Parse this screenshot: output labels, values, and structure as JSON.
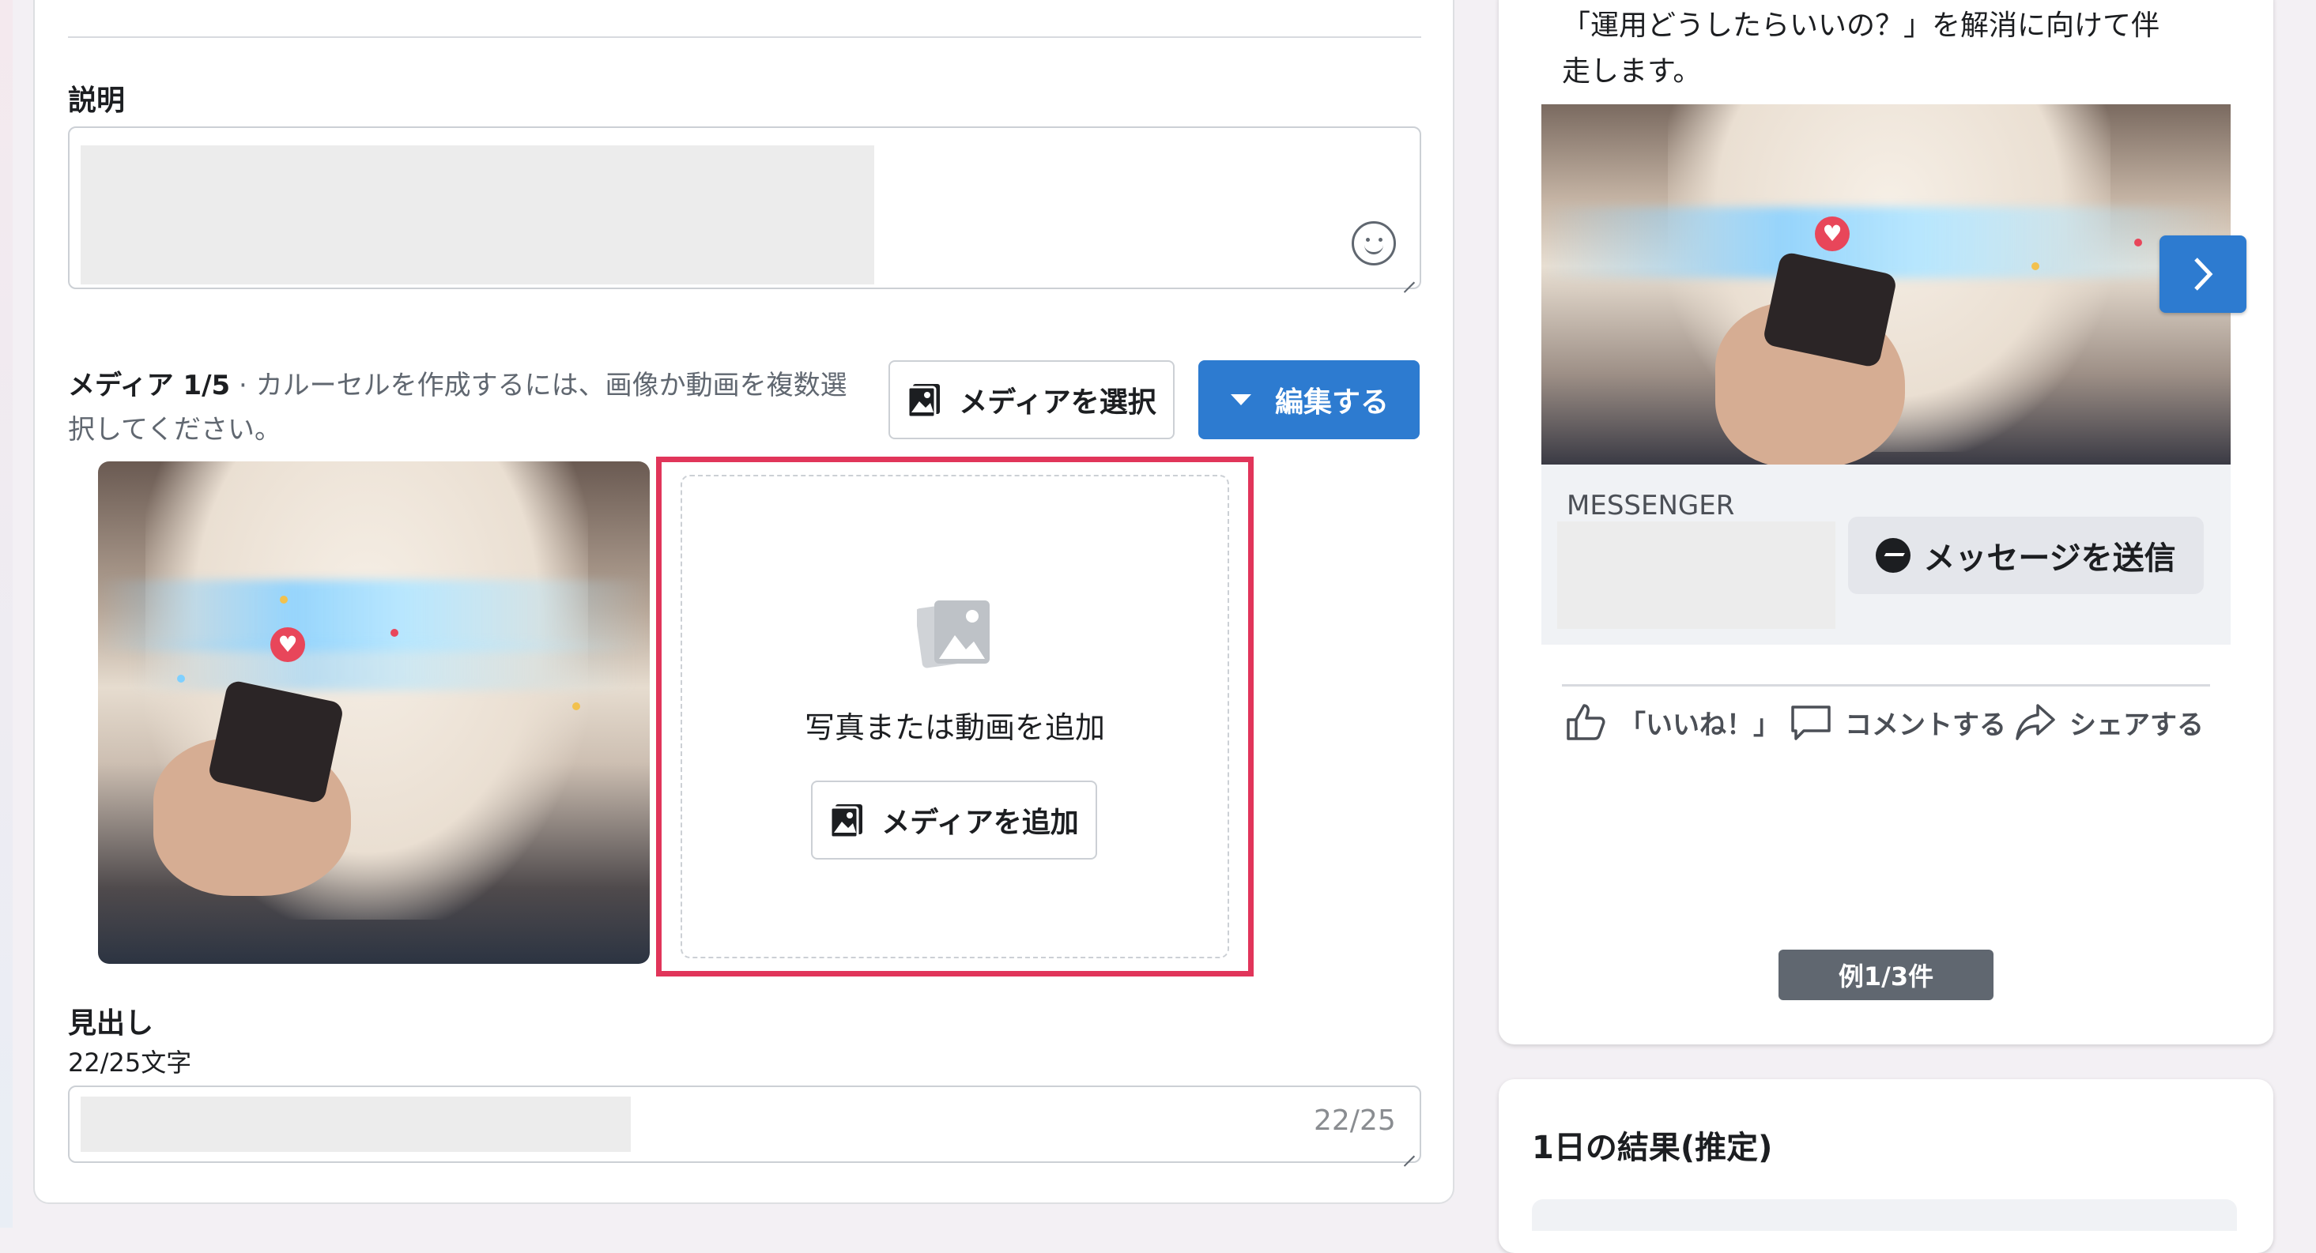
{
  "description": {
    "label": "説明"
  },
  "media": {
    "label": "メディア 1/5",
    "hint": " · カルーセルを作成するには、画像か動画を複数選択してください。",
    "select_button": "メディアを選択",
    "edit_button": "編集する",
    "add_prompt": "写真または動画を追加",
    "add_button": "メディアを追加"
  },
  "headline": {
    "label": "見出し",
    "char_count": "22/25文字",
    "counter": "22/25"
  },
  "preview": {
    "body_text_line1": "「運用どうしたらいいの？」を解消に向けて伴",
    "body_text_line2": "走します。",
    "cta_label": "MESSENGER",
    "cta_button": "メッセージを送信",
    "like": "「いいね！」",
    "comment": "コメントする",
    "share": "シェアする",
    "pager": "例1/3件"
  },
  "results": {
    "title": "1日の結果(推定)"
  },
  "colors": {
    "accent_blue": "#2d7bd0",
    "highlight_red": "#e1355a"
  }
}
